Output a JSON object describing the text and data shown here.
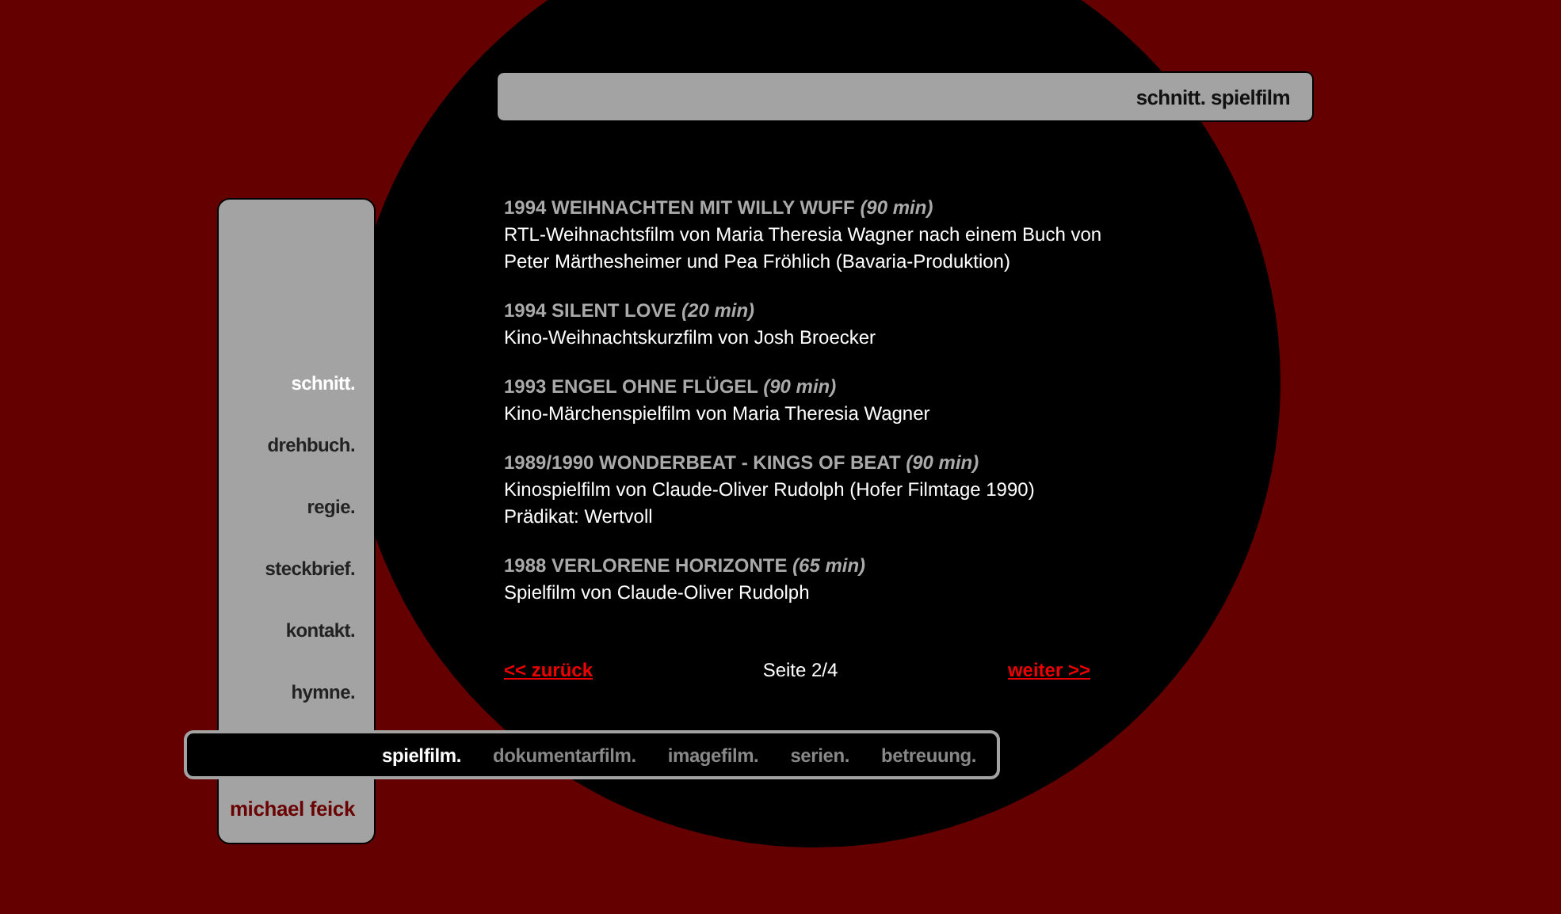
{
  "header": {
    "title": "schnitt. spielfilm"
  },
  "sidebar": {
    "items": [
      {
        "label": "schnitt.",
        "selected": true
      },
      {
        "label": "drehbuch.",
        "selected": false
      },
      {
        "label": "regie.",
        "selected": false
      },
      {
        "label": "steckbrief.",
        "selected": false
      },
      {
        "label": "kontakt.",
        "selected": false
      },
      {
        "label": "hymne.",
        "selected": false
      }
    ],
    "footer": "michael feick"
  },
  "films": [
    {
      "title": "1994 WEIHNACHTEN MIT WILLY WUFF *(90 min)*",
      "lines": [
        "RTL-Weihnachtsfilm von Maria Theresia Wagner nach einem Buch von",
        "Peter Märthesheimer und Pea Fröhlich (Bavaria-Produktion)"
      ]
    },
    {
      "title": "1994 SILENT LOVE *(20 min)*",
      "lines": [
        "Kino-Weihnachtskurzfilm von Josh Broecker"
      ]
    },
    {
      "title": "1993 ENGEL OHNE FLÜGEL *(90 min)*",
      "lines": [
        "Kino-Märchenspielfilm von Maria Theresia Wagner"
      ]
    },
    {
      "title": "1989/1990 WONDERBEAT - KINGS OF BEAT *(90 min)*",
      "lines": [
        "Kinospielfilm von Claude-Oliver Rudolph (Hofer Filmtage 1990)",
        "Prädikat: Wertvoll"
      ]
    },
    {
      "title": "1988 VERLORENE HORIZONTE *(65 min)*",
      "lines": [
        "Spielfilm von Claude-Oliver Rudolph"
      ]
    }
  ],
  "pagination": {
    "previous": "<< zurück",
    "page": "Seite 2/4",
    "next": "weiter >>"
  },
  "subnav": {
    "items": [
      {
        "label": "spielfilm.",
        "selected": true
      },
      {
        "label": "dokumentarfilm.",
        "selected": false
      },
      {
        "label": "imagefilm.",
        "selected": false
      },
      {
        "label": "serien.",
        "selected": false
      },
      {
        "label": "betreuung.",
        "selected": false
      }
    ]
  }
}
